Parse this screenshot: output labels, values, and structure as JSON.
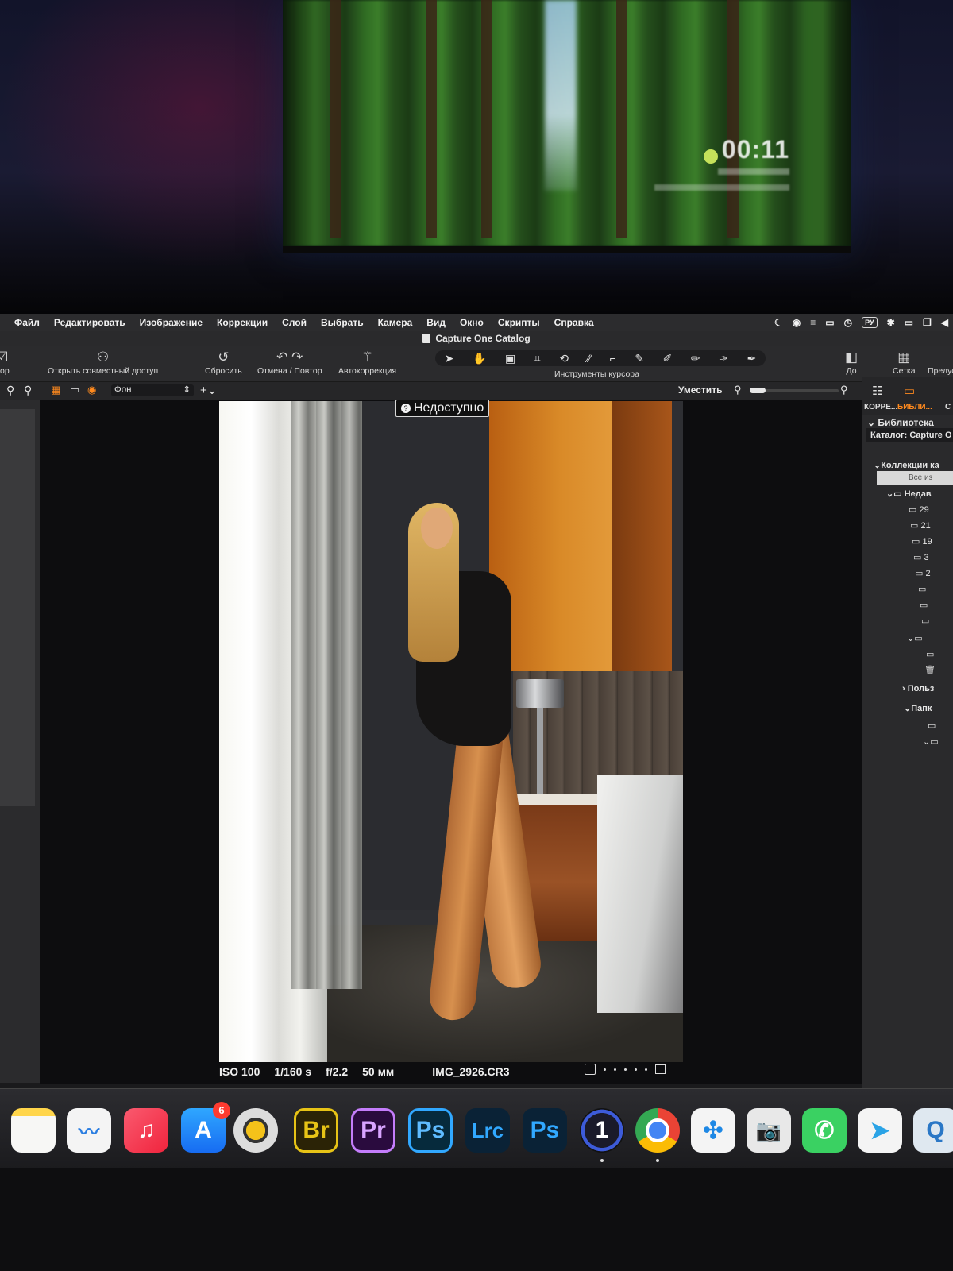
{
  "menubar": {
    "items": [
      "Файл",
      "Редактировать",
      "Изображение",
      "Коррекции",
      "Слой",
      "Выбрать",
      "Камера",
      "Вид",
      "Окно",
      "Скрипты",
      "Справка"
    ],
    "input_source": "РУ"
  },
  "window": {
    "title": "Capture One Catalog"
  },
  "toolbar": {
    "left_cut": "бор",
    "share": "Открыть совместный доступ",
    "reset": "Сбросить",
    "undo_redo": "Отмена / Повтор",
    "autocorrect": "Автокоррекция",
    "cursor_tools": "Инструменты курсора",
    "before": "До",
    "grid": "Сетка",
    "preview_cut": "Предус"
  },
  "subbar": {
    "layer": "Фон",
    "fit": "Уместить"
  },
  "viewer": {
    "badge": "Недоступно",
    "meta": {
      "iso": "ISO 100",
      "shutter": "1/160 s",
      "aperture": "f/2.2",
      "focal": "50 мм",
      "file": "IMG_2926.CR3"
    }
  },
  "right_panel": {
    "tab_adjust": "КОРРЕ...",
    "tab_library": "БИБЛИ...",
    "tab_cut": "С",
    "library_title": "Библиотека",
    "catalog": "Каталог: Capture O",
    "collections": "Коллекции ка",
    "all_images": "Все из",
    "recent": "Недав",
    "recent_items": [
      "29",
      "21",
      "19",
      "3",
      "2"
    ],
    "user": "Польз",
    "folders": "Папк"
  },
  "tv": {
    "time": "00:11"
  },
  "dock": {
    "apps": [
      {
        "name": "Notes"
      },
      {
        "name": "Freeform"
      },
      {
        "name": "Music"
      },
      {
        "name": "App Store",
        "badge": "6"
      },
      {
        "name": "Compressor"
      },
      {
        "name": "Bridge",
        "label": "Br"
      },
      {
        "name": "Premiere Pro",
        "label": "Pr"
      },
      {
        "name": "Photoshop",
        "label": "Ps"
      },
      {
        "name": "Lightroom Classic",
        "label": "Lrc"
      },
      {
        "name": "Photoshop",
        "label": "Ps"
      },
      {
        "name": "Capture One",
        "label": "1"
      },
      {
        "name": "Chrome"
      },
      {
        "name": "Safari"
      },
      {
        "name": "Image Capture"
      },
      {
        "name": "WhatsApp"
      },
      {
        "name": "Telegram"
      },
      {
        "name": "QuickTime"
      }
    ],
    "appstore_badge": "6",
    "br": "Br",
    "pr": "Pr",
    "ps": "Ps",
    "lrc": "Lrc",
    "ps2": "Ps",
    "c1": "1"
  },
  "colors": {
    "accent": "#ff8a1e",
    "menubar": "#2c2c2e",
    "viewer_bg": "#0d0d0f"
  }
}
